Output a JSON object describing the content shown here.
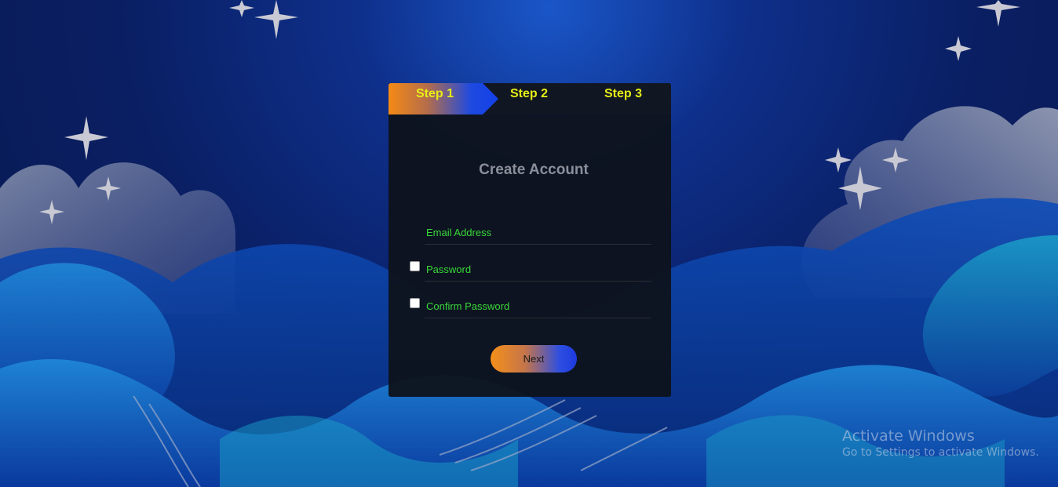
{
  "background": {
    "colors": {
      "sky": "#0a1f63",
      "wave_light": "#1b6fd0",
      "wave_teal": "#1aa0c8",
      "cloud": "#7d8aa8",
      "star": "#c9c9d4"
    }
  },
  "wizard": {
    "steps": [
      {
        "label": "Step 1",
        "active": true
      },
      {
        "label": "Step 2",
        "active": false
      },
      {
        "label": "Step 3",
        "active": false
      }
    ],
    "title": "Create Account",
    "fields": {
      "email": {
        "placeholder": "Email Address",
        "value": ""
      },
      "password": {
        "placeholder": "Password",
        "value": "",
        "checkbox_checked": false
      },
      "confirm_password": {
        "placeholder": "Confirm Password",
        "value": "",
        "checkbox_checked": false
      }
    },
    "next_label": "Next",
    "colors": {
      "accent_orange": "#f58a15",
      "accent_blue": "#1e4ae0",
      "step_text": "#e6f016",
      "field_text": "#39d839"
    }
  },
  "watermark": {
    "title": "Activate Windows",
    "subtitle": "Go to Settings to activate Windows."
  }
}
